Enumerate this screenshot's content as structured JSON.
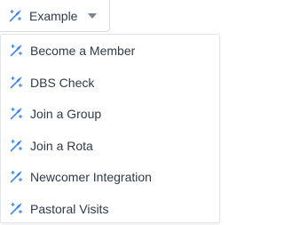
{
  "dropdown": {
    "selected_label": "Example",
    "icon": "magic-wand-icon",
    "caret_icon": "caret-down-icon",
    "accent_color": "#3f86ef",
    "items": [
      {
        "label": "Become a Member",
        "icon": "magic-wand-icon"
      },
      {
        "label": "DBS Check",
        "icon": "magic-wand-icon"
      },
      {
        "label": "Join a Group",
        "icon": "magic-wand-icon"
      },
      {
        "label": "Join a Rota",
        "icon": "magic-wand-icon"
      },
      {
        "label": "Newcomer Integration",
        "icon": "magic-wand-icon"
      },
      {
        "label": "Pastoral Visits",
        "icon": "magic-wand-icon"
      }
    ]
  }
}
